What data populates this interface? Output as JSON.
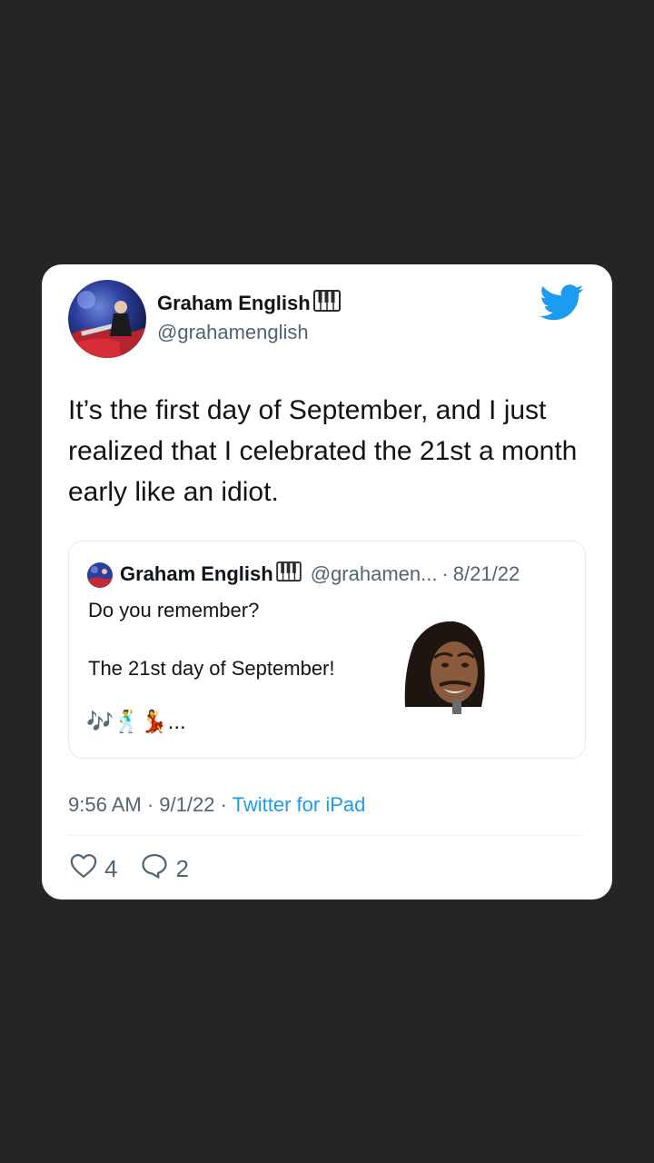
{
  "tweet": {
    "author_name": "Graham English",
    "author_handle": "@grahamenglish",
    "text": "It’s the first day of September, and I just realized that I celebrated the 21st a month early like an idiot.",
    "time": "9:56 AM",
    "date": "9/1/22",
    "separator": "·",
    "source": "Twitter for iPad",
    "likes": "4",
    "replies": "2"
  },
  "quoted_tweet": {
    "author_name": "Graham English",
    "author_handle": "@grahamen...",
    "separator": "·",
    "date": "8/21/22",
    "line1": "Do you remember?",
    "line2": "The 21st day of September!",
    "emoji_line": "🎶🕺💃..."
  },
  "icons": {
    "name_badge": "piano-keys-icon",
    "brand": "twitter-bird-icon",
    "like": "heart-outline-icon",
    "reply": "speech-bubble-icon"
  },
  "colors": {
    "background": "#262526",
    "card": "#ffffff",
    "text": "#0f1419",
    "muted": "#536471",
    "accent": "#1d9bf0"
  }
}
